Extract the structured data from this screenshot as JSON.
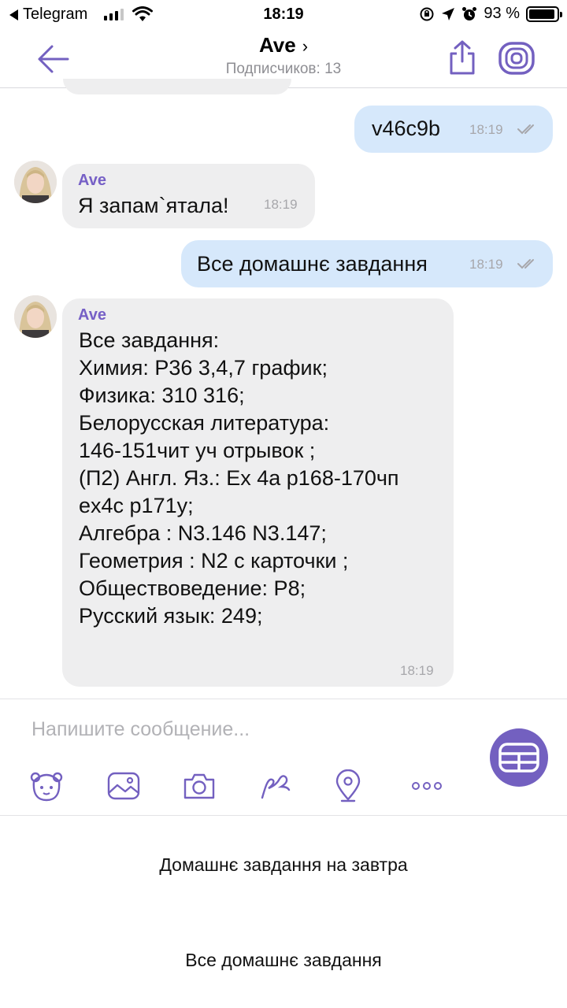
{
  "status_bar": {
    "back_app": "Telegram",
    "time": "18:19",
    "battery": "93 %",
    "battery_level": 0.93
  },
  "header": {
    "title": "Ave",
    "title_chevron": "›",
    "subtitle": "Подписчиков: 13",
    "back_icon": "arrow-left-icon",
    "share_icon": "share-icon",
    "viber_icon": "viber-icon"
  },
  "messages": [
    {
      "type": "outgoing",
      "text": "v46c9b",
      "time": "18:19"
    },
    {
      "type": "incoming",
      "sender": "Ave",
      "text": "Я запам`ятала!",
      "time": "18:19"
    },
    {
      "type": "outgoing",
      "text": "Все домашнє завдання",
      "time": "18:19"
    },
    {
      "type": "incoming",
      "sender": "Ave",
      "lines": [
        "Все завдання:",
        "Химия: Р36 3,4,7 график;",
        "Физика: 310 316;",
        "Белорусская литература:",
        "146-151чит уч отрывок ;",
        "(П2) Англ. Яз.: Ex 4a p168-170чп",
        "ex4c p171y;",
        "Алгебра : N3.146 N3.147;",
        "Геометрия : N2 с карточки ;",
        "Обществоведение: Р8;",
        "Русский язык: 249;"
      ],
      "time": "18:19"
    }
  ],
  "composer": {
    "placeholder": "Напишите сообщение...",
    "tools": [
      "sticker-icon",
      "gallery-icon",
      "camera-icon",
      "doodle-icon",
      "location-icon",
      "more-icon"
    ],
    "send_icon": "bot-keyboard-icon"
  },
  "quick_replies": [
    "Домашнє завдання на завтра",
    "Все домашнє завдання"
  ],
  "colors": {
    "accent": "#7360c0",
    "outgoing_bubble": "#d6e8fb",
    "incoming_bubble": "#eeeeef",
    "sender_name": "#7660c6"
  }
}
